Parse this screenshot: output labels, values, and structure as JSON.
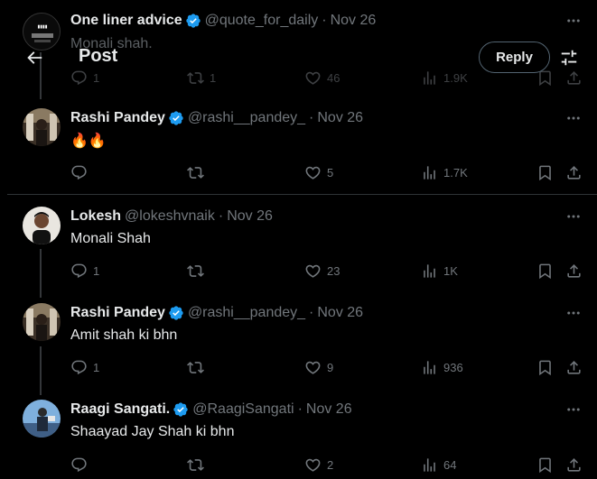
{
  "header": {
    "title": "Post",
    "reply_label": "Reply"
  },
  "tweets": [
    {
      "name": "One liner advice",
      "verified": true,
      "handle": "@quote_for_daily",
      "date": "Nov 26",
      "text": "Monali shah.",
      "replies": "1",
      "reposts": "1",
      "likes": "46",
      "views": "1.9K"
    },
    {
      "name": "Rashi Pandey",
      "verified": true,
      "handle": "@rashi__pandey_",
      "date": "Nov 26",
      "text": "🔥🔥",
      "replies": "",
      "reposts": "",
      "likes": "5",
      "views": "1.7K"
    },
    {
      "name": "Lokesh",
      "verified": false,
      "handle": "@lokeshvnaik",
      "date": "Nov 26",
      "text": "Monali Shah",
      "replies": "1",
      "reposts": "",
      "likes": "23",
      "views": "1K"
    },
    {
      "name": "Rashi Pandey",
      "verified": true,
      "handle": "@rashi__pandey_",
      "date": "Nov 26",
      "text": "Amit shah ki bhn",
      "replies": "1",
      "reposts": "",
      "likes": "9",
      "views": "936"
    },
    {
      "name": "Raagi Sangati.",
      "verified": true,
      "handle": "@RaagiSangati",
      "date": "Nov 26",
      "text": "Shaayad Jay Shah ki bhn",
      "replies": "",
      "reposts": "",
      "likes": "2",
      "views": "64"
    }
  ],
  "colors": {
    "background": "#000000",
    "text": "#e7e9ea",
    "muted": "#71767b",
    "verified": "#1d9bf0",
    "divider": "#2f3336"
  }
}
